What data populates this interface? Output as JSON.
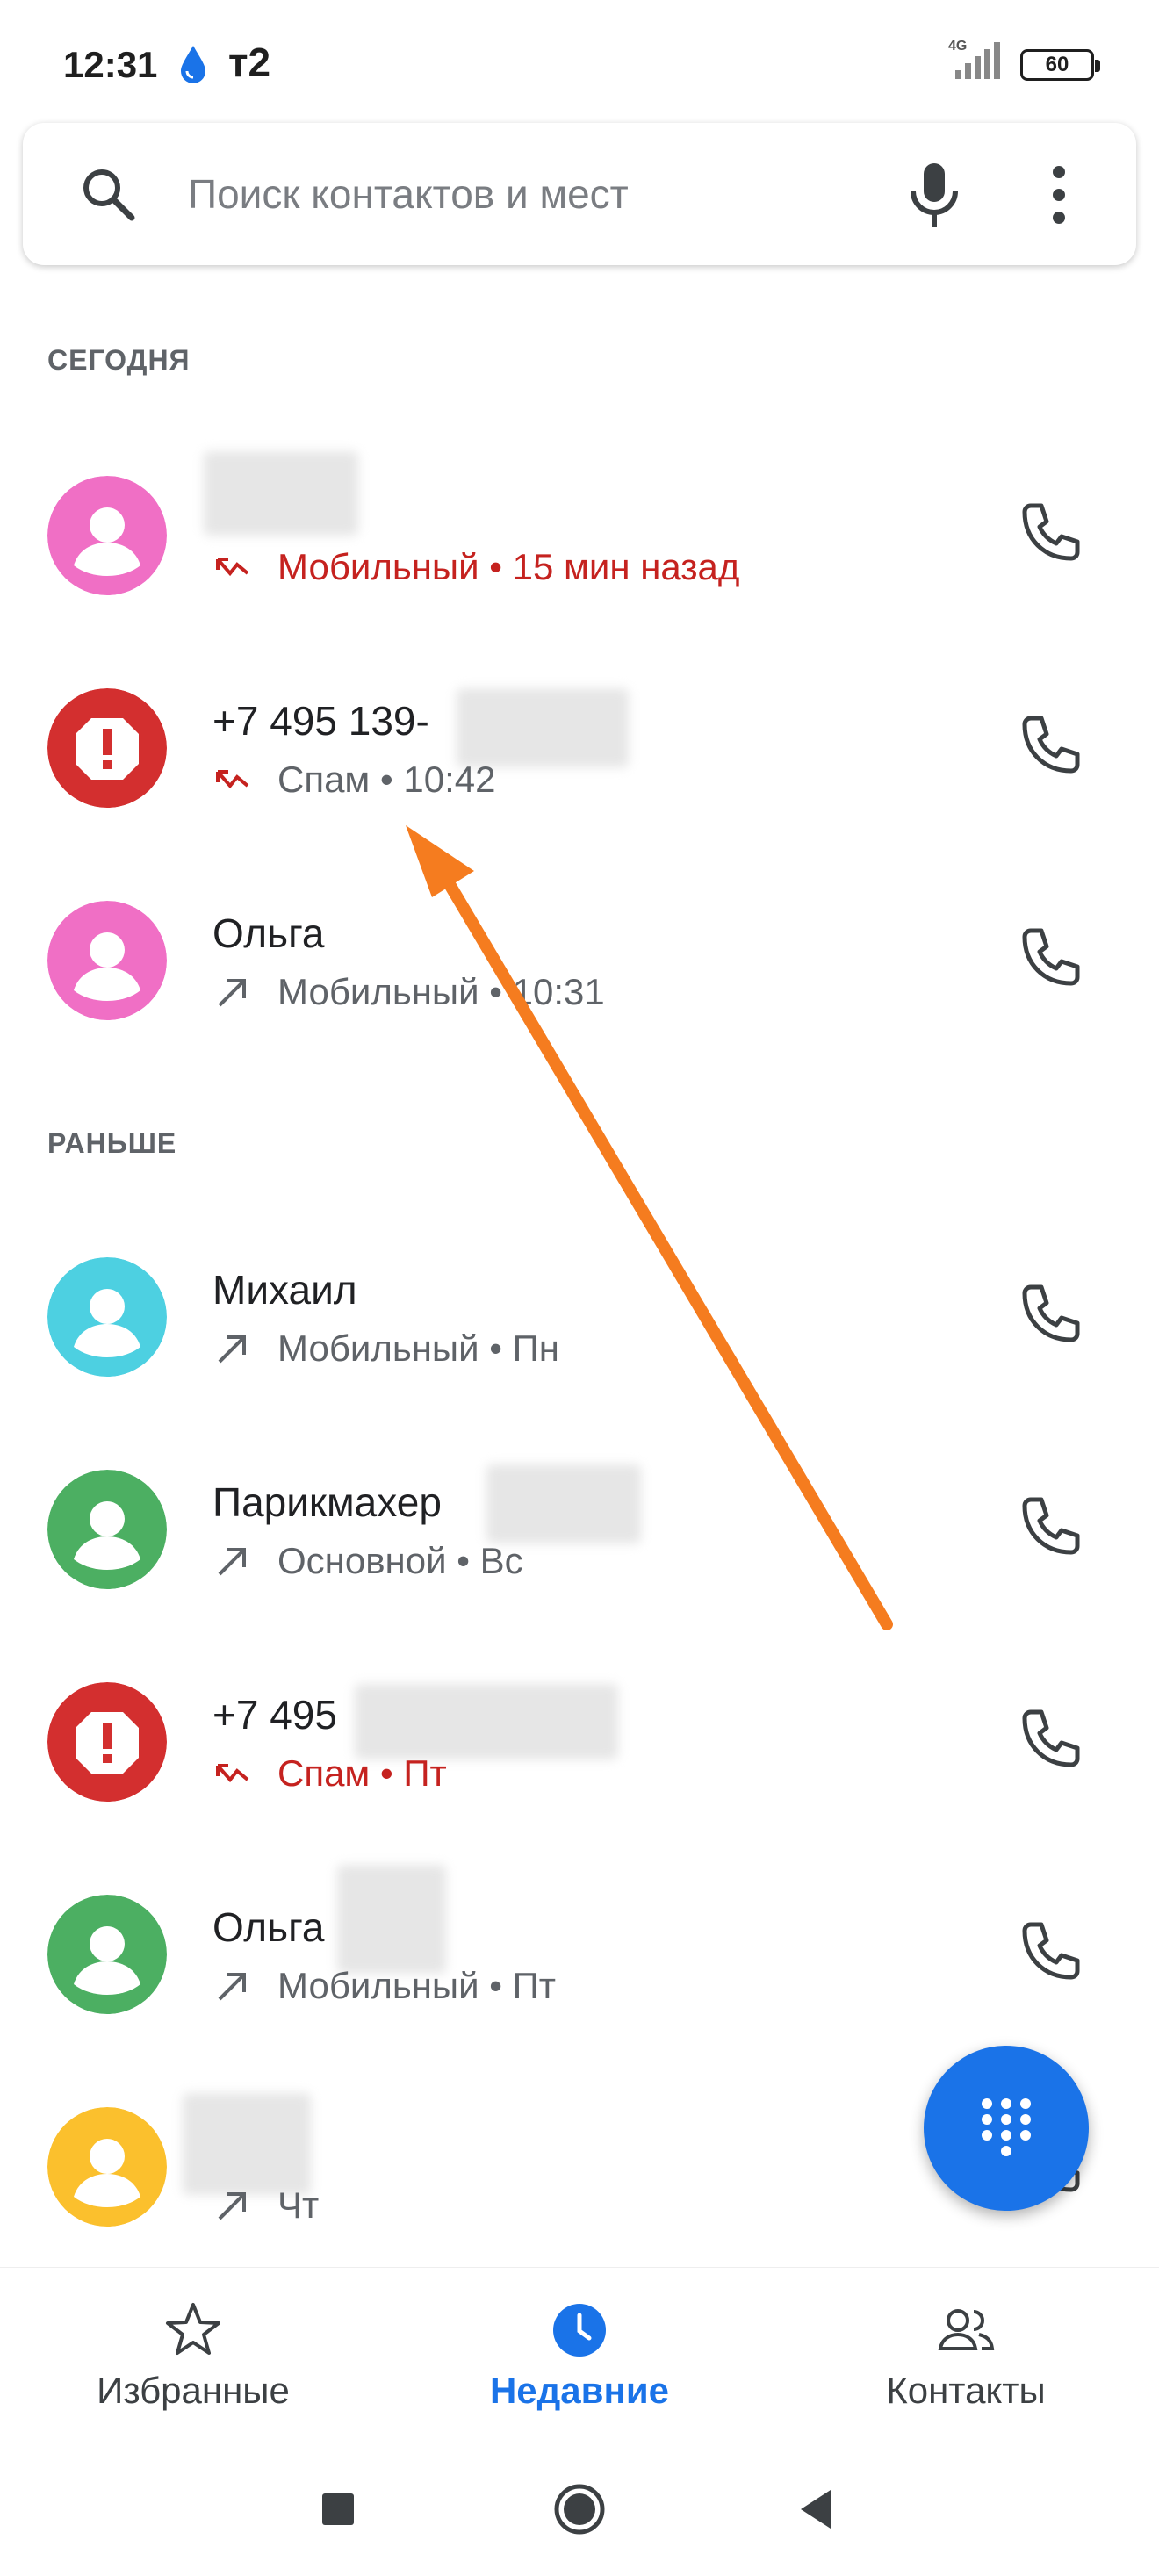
{
  "status_bar": {
    "time": "12:31",
    "carrier": "т2",
    "network": "4G",
    "battery": "60"
  },
  "search": {
    "placeholder": "Поиск контактов и мест"
  },
  "sections": {
    "today": "СЕГОДНЯ",
    "earlier": "РАНЬШЕ"
  },
  "calls": [
    {
      "name": "",
      "detail": "Мобильный • 15 мин назад",
      "type": "missed",
      "avatar": "person",
      "avatar_color": "#f06fc5"
    },
    {
      "name": "+7 495 139-",
      "detail": "Спам • 10:42",
      "type": "missed-spam",
      "avatar": "spam",
      "avatar_color": "#d32f2f"
    },
    {
      "name": "Ольга",
      "detail": "Мобильный • 10:31",
      "type": "outgoing",
      "avatar": "person",
      "avatar_color": "#f06fc5"
    },
    {
      "name": "Михаил",
      "detail": "Мобильный • Пн",
      "type": "outgoing",
      "avatar": "person",
      "avatar_color": "#4dd0e1"
    },
    {
      "name": "Парикмахер",
      "detail": "Основной • Вс",
      "type": "outgoing",
      "avatar": "person",
      "avatar_color": "#4caf62"
    },
    {
      "name": "+7 495",
      "detail": "Спам • Пт",
      "type": "missed",
      "avatar": "spam",
      "avatar_color": "#d32f2f"
    },
    {
      "name": "Ольга",
      "detail": "Мобильный • Пт",
      "type": "outgoing",
      "avatar": "person",
      "avatar_color": "#4caf62"
    },
    {
      "name": "",
      "detail": "Чт",
      "type": "outgoing",
      "avatar": "person",
      "avatar_color": "#fbc02d"
    }
  ],
  "bottom_nav": {
    "favorites": "Избранные",
    "recent": "Недавние",
    "contacts": "Контакты"
  },
  "colors": {
    "accent": "#1a73e8",
    "missed": "#c5221f",
    "annotation": "#f57c1f"
  }
}
